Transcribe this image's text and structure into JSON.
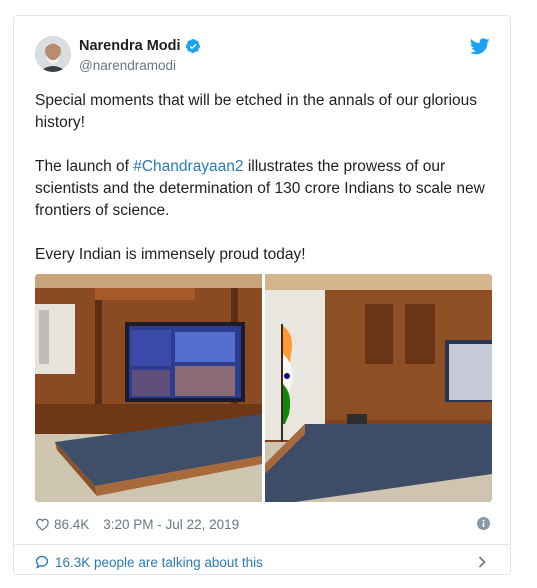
{
  "author": {
    "name": "Narendra Modi",
    "handle": "@narendramodi"
  },
  "tweet": {
    "paragraph1": "Special moments that will be etched in the annals of our glorious history!",
    "paragraph2_before": "The launch of ",
    "hashtag": "#Chandrayaan2",
    "paragraph2_after": " illustrates the prowess of our scientists and the determination of 130 crore Indians to scale new frontiers of science.",
    "paragraph3": "Every Indian is immensely proud today!"
  },
  "stats": {
    "likes": "86.4K",
    "timestamp": "3:20 PM - Jul 22, 2019"
  },
  "conversation": {
    "label": "16.3K people are talking about this"
  },
  "colors": {
    "link": "#2b7bb9",
    "muted": "#697882",
    "twitter_blue": "#1da1f2"
  },
  "icons": [
    "verified-badge-icon",
    "twitter-bird-icon",
    "heart-icon",
    "info-icon",
    "speech-bubble-icon",
    "chevron-right-icon"
  ]
}
